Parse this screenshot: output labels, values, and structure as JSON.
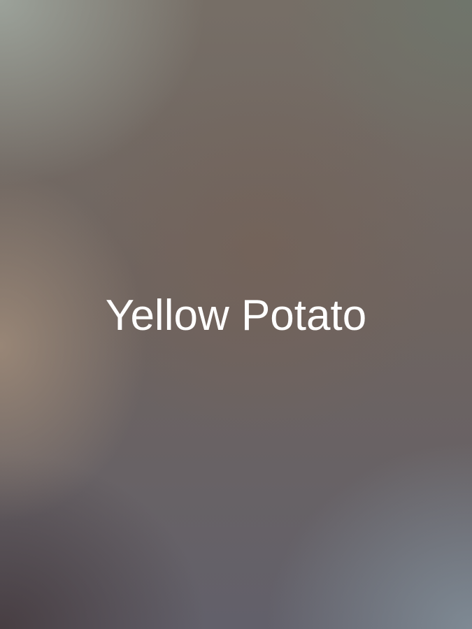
{
  "title": "Yellow Potato"
}
